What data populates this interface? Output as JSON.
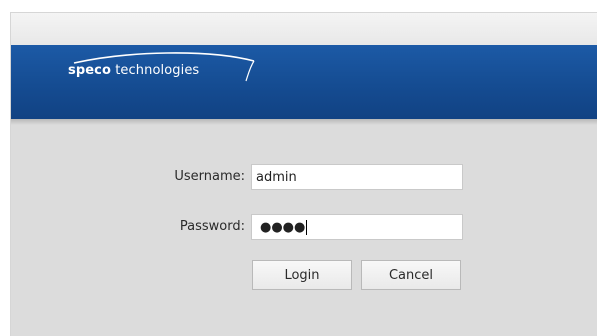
{
  "header": {
    "logo": {
      "brand": "speco",
      "rest": " technologies"
    }
  },
  "login_form": {
    "username_label": "Username:",
    "username_value": "admin",
    "password_label": "Password:",
    "password_masked": "●●●●",
    "login_button": "Login",
    "cancel_button": "Cancel"
  },
  "colors": {
    "banner_blue": "#1c5aa6",
    "panel_gray": "#dcdcdc"
  }
}
